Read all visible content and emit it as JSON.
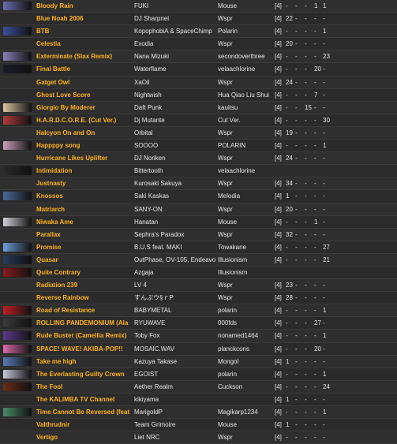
{
  "rows": [
    {
      "title": "Bloody Rain",
      "artist": "FUKI",
      "charter": "Mouse",
      "diff": "[4]",
      "c1": "-",
      "c2": "-",
      "c3": "-",
      "c4": "1",
      "c5": "1",
      "thumb_color": "#6b6bb0"
    },
    {
      "title": "Blue Noah 2006",
      "artist": "DJ Sharpnel",
      "charter": "Wspr",
      "diff": "[4]",
      "c1": "22",
      "c2": "-",
      "c3": "-",
      "c4": "-",
      "c5": "-",
      "thumb_color": ""
    },
    {
      "title": "BTB",
      "artist": "KopophobiA & SpaceChimp",
      "charter": "Polarin",
      "diff": "[4]",
      "c1": "-",
      "c2": "-",
      "c3": "-",
      "c4": "-",
      "c5": "1",
      "thumb_color": "#3a4f9a"
    },
    {
      "title": "Celestia",
      "artist": "Exodia",
      "charter": "Wspr",
      "diff": "[4]",
      "c1": "20",
      "c2": "-",
      "c3": "-",
      "c4": "-",
      "c5": "-",
      "thumb_color": ""
    },
    {
      "title": "Exterminate (Slax Remix)",
      "artist": "Nana Mizuki",
      "charter": "secondoverthree",
      "diff": "[4]",
      "c1": "-",
      "c2": "-",
      "c3": "-",
      "c4": "-",
      "c5": "23",
      "thumb_color": "#8a7fb8"
    },
    {
      "title": "Final Battle",
      "artist": "Waterflame",
      "charter": "velaachlorine",
      "diff": "[4]",
      "c1": "-",
      "c2": "-",
      "c3": "-",
      "c4": "20",
      "c5": "-",
      "thumb_color": "#1c1c2a"
    },
    {
      "title": "Gatget Owl",
      "artist": "XaOil",
      "charter": "Wspr",
      "diff": "[4]",
      "c1": "24",
      "c2": "-",
      "c3": "-",
      "c4": "-",
      "c5": "-",
      "thumb_color": ""
    },
    {
      "title": "Ghost Love Score",
      "artist": "Nightwish",
      "charter": "Hua Qiao Liu Shui",
      "diff": "[4]",
      "c1": "-",
      "c2": "-",
      "c3": "-",
      "c4": "7",
      "c5": "-",
      "thumb_color": ""
    },
    {
      "title": "Giorgio By Moderer",
      "artist": "Daft Punk",
      "charter": "kauitsu",
      "diff": "[4]",
      "c1": "-",
      "c2": "-",
      "c3": "15",
      "c4": "-",
      "c5": "-",
      "thumb_color": "#d9c8a0"
    },
    {
      "title": "H.A.R.D.C.O.R.E. (Cut Ver.)",
      "artist": "Dj Mutante",
      "charter": "Cut Ver.",
      "diff": "[4]",
      "c1": "-",
      "c2": "-",
      "c3": "-",
      "c4": "-",
      "c5": "30",
      "thumb_color": "#b03a3a"
    },
    {
      "title": "Halcyon On and On",
      "artist": "Orbital",
      "charter": "Wspr",
      "diff": "[4]",
      "c1": "19",
      "c2": "-",
      "c3": "-",
      "c4": "-",
      "c5": "-",
      "thumb_color": ""
    },
    {
      "title": "Happppy song",
      "artist": "SOOOO",
      "charter": "POLARIN",
      "diff": "[4]",
      "c1": "-",
      "c2": "-",
      "c3": "-",
      "c4": "-",
      "c5": "1",
      "thumb_color": "#c8a0b8"
    },
    {
      "title": "Hurricane Likes Uplifter",
      "artist": "DJ Noriken",
      "charter": "Wspr",
      "diff": "[4]",
      "c1": "24",
      "c2": "-",
      "c3": "-",
      "c4": "-",
      "c5": "-",
      "thumb_color": ""
    },
    {
      "title": "Intimidation",
      "artist": "Bittertooth",
      "charter": "velaachlorine",
      "diff": "",
      "c1": "",
      "c2": "",
      "c3": "",
      "c4": "",
      "c5": "",
      "thumb_color": "#2a2a2a"
    },
    {
      "title": "Justnasty",
      "artist": "Kurosaki Sakuya",
      "charter": "Wspr",
      "diff": "[4]",
      "c1": "34",
      "c2": "-",
      "c3": "-",
      "c4": "-",
      "c5": "-",
      "thumb_color": ""
    },
    {
      "title": "Knossos",
      "artist": "Saki Kaskas",
      "charter": "Melodia",
      "diff": "[4]",
      "c1": "1",
      "c2": "-",
      "c3": "-",
      "c4": "-",
      "c5": "-",
      "thumb_color": "#4a6a9a"
    },
    {
      "title": "Matriarch",
      "artist": "SANY-ON",
      "charter": "Wspr",
      "diff": "[4]",
      "c1": "20",
      "c2": "-",
      "c3": "-",
      "c4": "-",
      "c5": "-",
      "thumb_color": ""
    },
    {
      "title": "Niwaka Ame",
      "artist": "Hanatan",
      "charter": "Mouse",
      "diff": "[4]",
      "c1": "-",
      "c2": "-",
      "c3": "-",
      "c4": "1",
      "c5": "-",
      "thumb_color": "#d0d0d8"
    },
    {
      "title": "Parallax",
      "artist": "Sephra's Paradox",
      "charter": "Wspr",
      "diff": "[4]",
      "c1": "32",
      "c2": "-",
      "c3": "-",
      "c4": "-",
      "c5": "-",
      "thumb_color": ""
    },
    {
      "title": "Promise",
      "artist": "B.U.S feat. MAKI",
      "charter": "Towakane",
      "diff": "[4]",
      "c1": "-",
      "c2": "-",
      "c3": "-",
      "c4": "-",
      "c5": "27",
      "thumb_color": "#6aa0d8"
    },
    {
      "title": "Quasar",
      "artist": "OutPhase, OV-105, Endeavour",
      "charter": "Illusionism",
      "diff": "[4]",
      "c1": "-",
      "c2": "-",
      "c3": "-",
      "c4": "-",
      "c5": "21",
      "thumb_color": "#2a3a5a"
    },
    {
      "title": "Quite Contrary",
      "artist": "Azgaja",
      "charter": "Illusionism",
      "diff": "",
      "c1": "",
      "c2": "",
      "c3": "",
      "c4": "",
      "c5": "",
      "thumb_color": "#8a1a1a"
    },
    {
      "title": "Radiation 239",
      "artist": "LV 4",
      "charter": "Wspr",
      "diff": "[4]",
      "c1": "23",
      "c2": "-",
      "c3": "-",
      "c4": "-",
      "c5": "-",
      "thumb_color": ""
    },
    {
      "title": "Reverse Rainbow",
      "artist": "すんぷウ§ｒP",
      "charter": "Wspr",
      "diff": "[4]",
      "c1": "28",
      "c2": "-",
      "c3": "-",
      "c4": "-",
      "c5": "-",
      "thumb_color": ""
    },
    {
      "title": "Road of Resistance",
      "artist": "BABYMETAL",
      "charter": "polarin",
      "diff": "[4]",
      "c1": "-",
      "c2": "-",
      "c3": "-",
      "c4": "-",
      "c5": "1",
      "thumb_color": "#c02020"
    },
    {
      "title": "ROLLING PANDEMONIUM (Ala",
      "artist": "RYUWAVE",
      "charter": "000fds",
      "diff": "[4]",
      "c1": "-",
      "c2": "-",
      "c3": "-",
      "c4": "27",
      "c5": "-",
      "thumb_color": "#3a3a3a"
    },
    {
      "title": "Rude Buster (Camellia Remix)",
      "artist": "Toby Fox",
      "charter": "nonamed1464",
      "diff": "[4]",
      "c1": "-",
      "c2": "-",
      "c3": "-",
      "c4": "-",
      "c5": "1",
      "thumb_color": "#5a3a8a"
    },
    {
      "title": "SPACE! WAVE! AKIBA-POP!!",
      "artist": "MOSAIC.WAV",
      "charter": "planckcons",
      "diff": "[4]",
      "c1": "-",
      "c2": "-",
      "c3": "-",
      "c4": "20",
      "c5": "-",
      "thumb_color": "#d86aa8"
    },
    {
      "title": "Take me high",
      "artist": "Kazuya Takase",
      "charter": "Mongol",
      "diff": "[4]",
      "c1": "1",
      "c2": "-",
      "c3": "-",
      "c4": "-",
      "c5": "-",
      "thumb_color": "#5a7ab8"
    },
    {
      "title": "The Everlasting Guilty Crown",
      "artist": "EGOIST",
      "charter": "polarin",
      "diff": "[4]",
      "c1": "-",
      "c2": "-",
      "c3": "-",
      "c4": "-",
      "c5": "1",
      "thumb_color": "#c8c8d8"
    },
    {
      "title": "The Fool",
      "artist": "Aether Realm",
      "charter": "Cuckson",
      "diff": "[4]",
      "c1": "-",
      "c2": "-",
      "c3": "-",
      "c4": "-",
      "c5": "24",
      "thumb_color": "#6a2a1a"
    },
    {
      "title": "The KALIMBA TV Channel",
      "artist": "kikiyama",
      "charter": "",
      "diff": "[4]",
      "c1": "1",
      "c2": "-",
      "c3": "-",
      "c4": "-",
      "c5": "-",
      "thumb_color": ""
    },
    {
      "title": "Time Cannot Be Reversed (feat.",
      "artist": "MarigoldP",
      "charter": "Magikarp1234",
      "diff": "[4]",
      "c1": "-",
      "c2": "-",
      "c3": "-",
      "c4": "-",
      "c5": "1",
      "thumb_color": "#4a8a6a"
    },
    {
      "title": "Valthrudnir",
      "artist": "Team Grimoire",
      "charter": "Mouse",
      "diff": "[4]",
      "c1": "1",
      "c2": "-",
      "c3": "-",
      "c4": "-",
      "c5": "-",
      "thumb_color": ""
    },
    {
      "title": "Vertigo",
      "artist": "Liet NRC",
      "charter": "Wspr",
      "diff": "[4]",
      "c1": "-",
      "c2": "-",
      "c3": "-",
      "c4": "-",
      "c5": "-",
      "thumb_color": ""
    }
  ]
}
